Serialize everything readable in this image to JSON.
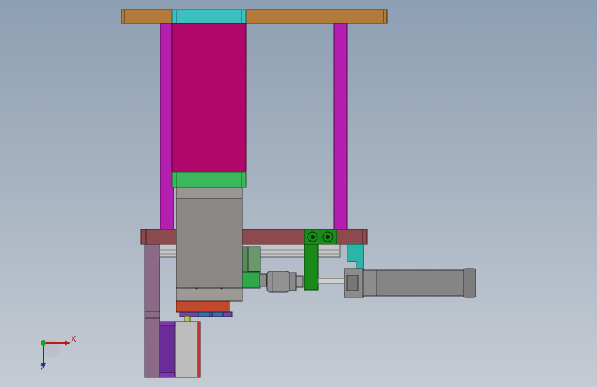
{
  "viewport": {
    "background_top": "#8d9fb3",
    "background_bottom": "#c5cbd3"
  },
  "triad": {
    "x_label": "X",
    "z_label": "Z",
    "x_color": "#c01818",
    "z_color": "#1c2ea8",
    "origin_color": "#1aa01a"
  },
  "colors": {
    "top_plate": "#b37a3c",
    "top_plate_center": "#3cbfbf",
    "posts": "#b41fb0",
    "motor_housing": "#b0086a",
    "motor_flange": "#3cb85c",
    "gear_block": "#8a8784",
    "base_plate": "#8c4a4e",
    "side_frame": "#8a6a86",
    "rail": "#c6c6c6",
    "lever": "#1a8a1a",
    "bracket": "#2bb5a8",
    "cylinder": "#858585",
    "lower_block": "#6a2c98",
    "lower_body": "#bdbdbd",
    "lower_cap": "#c8302a",
    "guide_block": "#c24a2c"
  }
}
